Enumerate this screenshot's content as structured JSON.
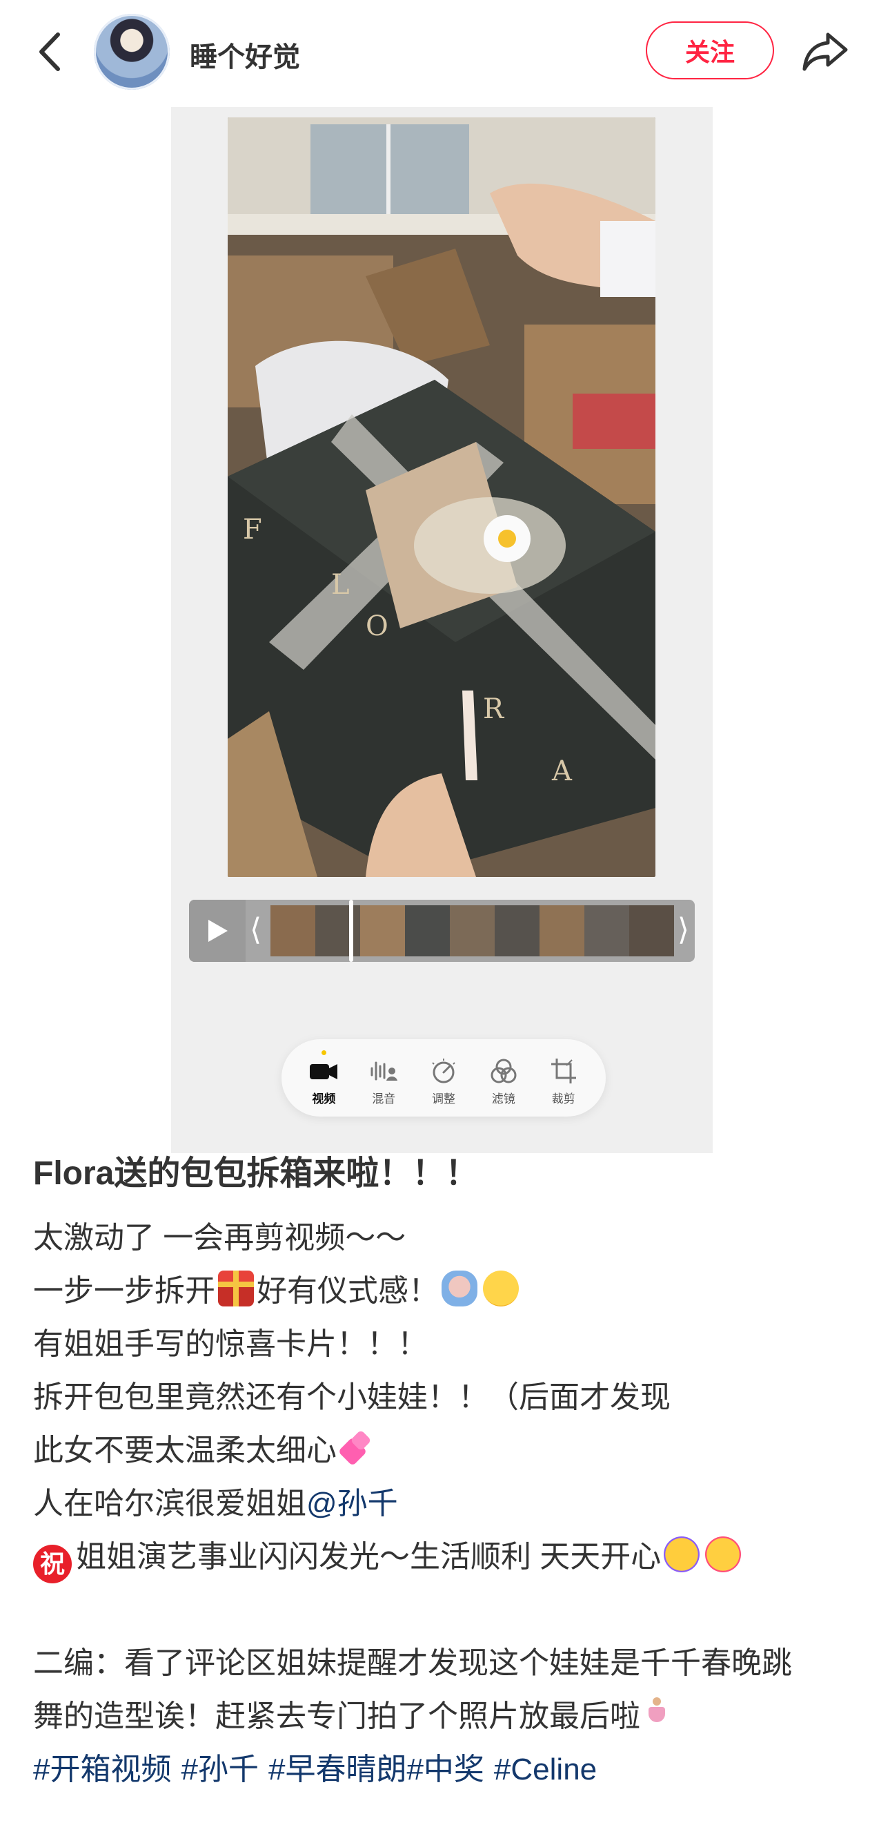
{
  "header": {
    "username": "睡个好觉",
    "follow_label": "关注"
  },
  "editor": {
    "tools": [
      {
        "label": "视频",
        "icon": "video-camera-icon",
        "active": true
      },
      {
        "label": "混音",
        "icon": "audio-mix-icon",
        "active": false
      },
      {
        "label": "调整",
        "icon": "adjust-dial-icon",
        "active": false
      },
      {
        "label": "滤镜",
        "icon": "filter-circles-icon",
        "active": false
      },
      {
        "label": "裁剪",
        "icon": "crop-icon",
        "active": false
      }
    ]
  },
  "post": {
    "title": "Flora送的包包拆箱来啦！！！",
    "line1": "太激动了 一会再剪视频～～",
    "line2a": "一步一步拆开",
    "line2b": "好有仪式感！",
    "line3": "有姐姐手写的惊喜卡片！！！",
    "line4": "拆开包包里竟然还有个小娃娃！！（后面才发现",
    "line5": "此女不要太温柔太细心",
    "line6": "人在哈尔滨很爱姐姐",
    "mention": "@孙千",
    "zhu_char": "祝",
    "line7": "姐姐演艺事业闪闪发光～生活顺利 天天开心",
    "line8": "二编：看了评论区姐妹提醒才发现这个娃娃是千千春晚跳",
    "line9": "舞的造型诶！赶紧去专门拍了个照片放最后啦",
    "tags": [
      "#开箱视频",
      "#孙千",
      "#早春晴朗#中奖",
      "#Celine"
    ]
  }
}
